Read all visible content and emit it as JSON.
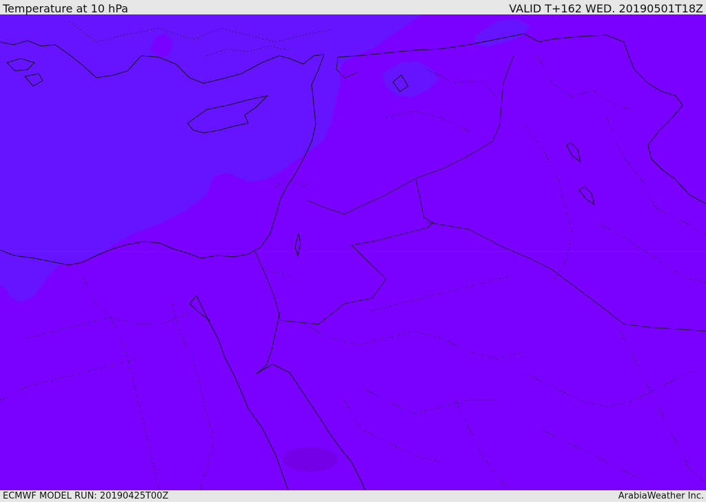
{
  "header": {
    "title": "Temperature at 10 hPa",
    "valid": "VALID T+162 WED. 20190501T18Z"
  },
  "footer": {
    "run": "ECMWF MODEL RUN: 20190425T00Z",
    "brand": "ArabiaWeather Inc."
  },
  "colors": {
    "field_main": "#7a00ff",
    "field_cool": "#6614ff",
    "field_warm_patch": "#7300e6",
    "coastline": "#111111",
    "border": "#222222"
  }
}
